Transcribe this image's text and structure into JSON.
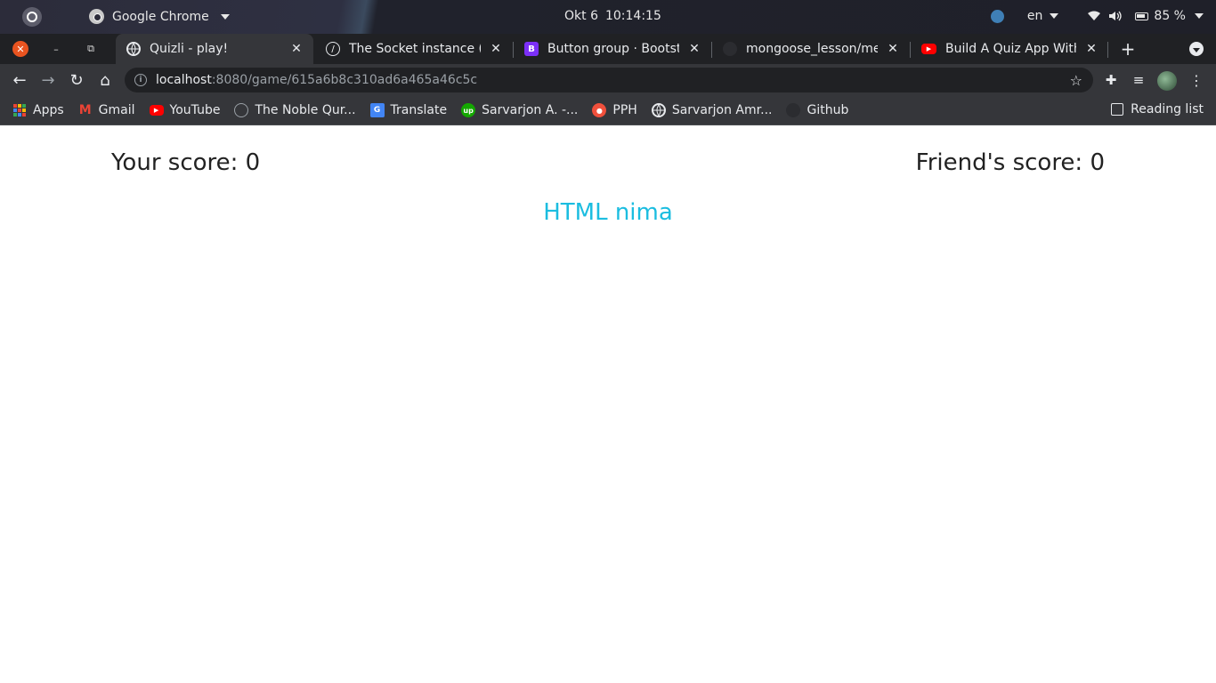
{
  "system_bar": {
    "app_name": "Google Chrome",
    "date": "Okt 6",
    "time": "10:14:15",
    "language": "en",
    "battery": "85 %"
  },
  "tabs": [
    {
      "title": "Quizli - play!",
      "active": true,
      "icon": "globe-icon"
    },
    {
      "title": "The Socket instance (cli",
      "active": false,
      "icon": "socketio-icon"
    },
    {
      "title": "Button group · Bootstr",
      "active": false,
      "icon": "bootstrap-icon"
    },
    {
      "title": "mongoose_lesson/mes",
      "active": false,
      "icon": "github-icon"
    },
    {
      "title": "Build A Quiz App With",
      "active": false,
      "icon": "youtube-icon"
    }
  ],
  "address_bar": {
    "host": "localhost",
    "path": ":8080/game/615a6b8c310ad6a465a46c5c"
  },
  "bookmarks": [
    {
      "label": "Apps",
      "icon": "apps-grid-icon"
    },
    {
      "label": "Gmail",
      "icon": "gmail-icon"
    },
    {
      "label": "YouTube",
      "icon": "youtube-icon"
    },
    {
      "label": "The Noble Qur...",
      "icon": "quran-icon"
    },
    {
      "label": "Translate",
      "icon": "translate-icon"
    },
    {
      "label": "Sarvarjon A. -...",
      "icon": "upwork-icon"
    },
    {
      "label": "PPH",
      "icon": "pph-icon"
    },
    {
      "label": "Sarvarjon Amr...",
      "icon": "globe-icon"
    },
    {
      "label": "Github",
      "icon": "github-icon"
    }
  ],
  "reading_list": "Reading list",
  "game": {
    "your_score": "Your score: 0",
    "friend_score": "Friend's score: 0",
    "question": "HTML nima"
  },
  "colors": {
    "question": "#1bbde0",
    "ubuntu_close": "#e95420"
  }
}
